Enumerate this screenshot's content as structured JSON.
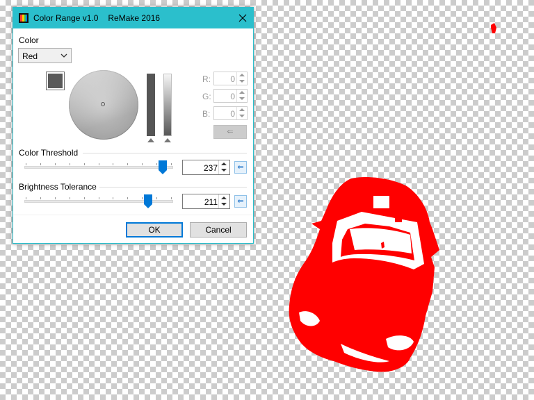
{
  "dialog": {
    "title": "Color Range v1.0",
    "subtitle": "ReMake 2016",
    "close_icon": "close-icon",
    "app_icon": "color-palette-icon"
  },
  "color": {
    "section_label": "Color",
    "selected": "Red",
    "swatch_color": "#595959"
  },
  "rgb": {
    "r_label": "R:",
    "r_value": "0",
    "g_label": "G:",
    "g_value": "0",
    "b_label": "B:",
    "b_value": "0",
    "apply_icon": "arrow-left-icon"
  },
  "threshold": {
    "label": "Color Threshold",
    "value": "237",
    "level": 0.93
  },
  "brightness": {
    "label": "Brightness Tolerance",
    "value": "211",
    "level": 0.83
  },
  "buttons": {
    "ok": "OK",
    "cancel": "Cancel"
  },
  "colors": {
    "title_bar": "#2bbfcc",
    "accent": "#0078d7",
    "shape_fill": "#ff0000"
  }
}
